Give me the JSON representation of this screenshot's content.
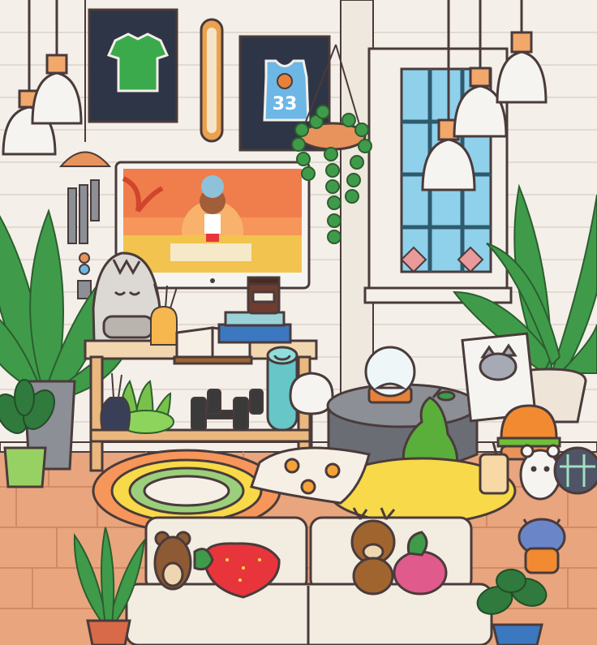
{
  "scene": {
    "jersey_number": "33"
  },
  "colors": {
    "wall": "#f4efe8",
    "wall_lines": "#e2d9cf",
    "floor": "#e8a57e",
    "floor_lines": "#d98b64",
    "outline": "#4a3b3b",
    "plant_green": "#3f9b4a",
    "sunset_orange": "#f7965a",
    "rug_yellow": "#f7d949",
    "sofa": "#f3ece1",
    "strawberry": "#e8353c",
    "pear": "#5aae3a",
    "window_glass": "#8fd0ea"
  }
}
